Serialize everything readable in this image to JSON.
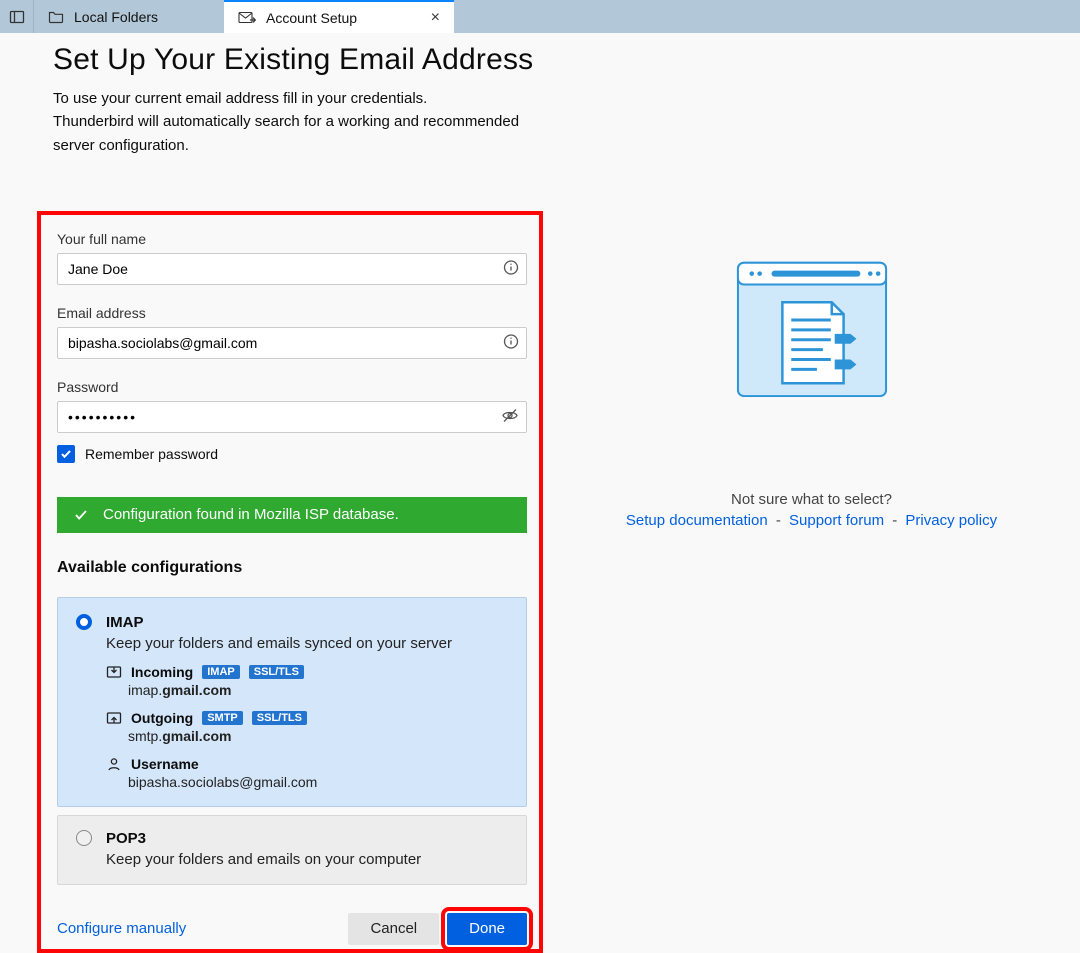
{
  "tabs": {
    "local_folders": "Local Folders",
    "account_setup": "Account Setup"
  },
  "header": {
    "title": "Set Up Your Existing Email Address",
    "sub1": "To use your current email address fill in your credentials.",
    "sub2": "Thunderbird will automatically search for a working and recommended server configuration."
  },
  "form": {
    "name_label": "Your full name",
    "name_value": "Jane Doe",
    "email_label": "Email address",
    "email_value": "bipasha.sociolabs@gmail.com",
    "pw_label": "Password",
    "pw_value": "••••••••••",
    "remember_label": "Remember password"
  },
  "banner": "Configuration found in Mozilla ISP database.",
  "configs": {
    "title": "Available configurations",
    "imap": {
      "label": "IMAP",
      "desc": "Keep your folders and emails synced on your server",
      "incoming_label": "Incoming",
      "incoming_proto": "IMAP",
      "incoming_sec": "SSL/TLS",
      "incoming_host_pre": "imap.",
      "incoming_host_bold": "gmail.com",
      "outgoing_label": "Outgoing",
      "outgoing_proto": "SMTP",
      "outgoing_sec": "SSL/TLS",
      "outgoing_host_pre": "smtp.",
      "outgoing_host_bold": "gmail.com",
      "user_label": "Username",
      "user_value": "bipasha.sociolabs@gmail.com"
    },
    "pop3": {
      "label": "POP3",
      "desc": "Keep your folders and emails on your computer"
    }
  },
  "buttons": {
    "manual": "Configure manually",
    "cancel": "Cancel",
    "done": "Done"
  },
  "help": {
    "prompt": "Not sure what to select?",
    "doc": "Setup documentation",
    "forum": "Support forum",
    "privacy": "Privacy policy"
  }
}
